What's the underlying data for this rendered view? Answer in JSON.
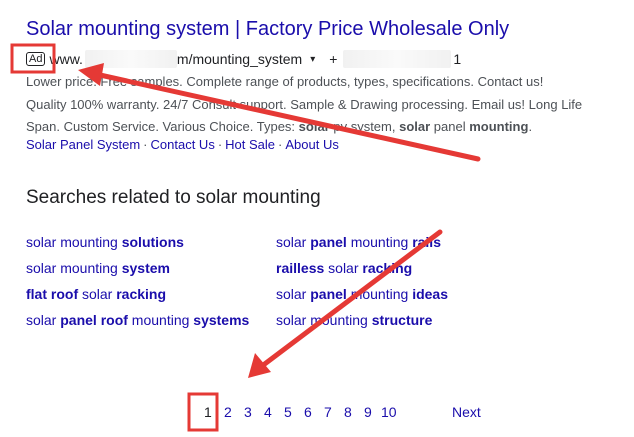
{
  "ad": {
    "title": "Solar mounting system | Factory Price Wholesale Only",
    "badge": "Ad",
    "url_prefix": "www.",
    "url_path": "m/mounting_system",
    "caret": "▾",
    "phone_prefix": "+",
    "phone_suffix": "1",
    "desc_line1": "Lower price. Free samples. Complete range of products, types, specifications. Contact us!",
    "desc_line2": "Quality 100% warranty. 24/7 Consult support. Sample & Drawing processing. Email us! Long Life",
    "desc_line3": {
      "part1": "Span. Custom Service. Various Choice. Types: ",
      "bold1": "solar",
      "part2": " pv system, ",
      "bold2": "solar",
      "part3": " panel ",
      "bold3": "mounting",
      "part4": "."
    },
    "sitelinks": [
      "Solar Panel System",
      "Contact Us",
      "Hot Sale",
      "About Us"
    ],
    "sitelink_separator": "·"
  },
  "related": {
    "heading": "Searches related to solar mounting",
    "left": [
      {
        "normal": "solar mounting ",
        "bold": "solutions"
      },
      {
        "normal": "solar mounting ",
        "bold": "system"
      },
      {
        "bold1": "flat roof",
        "normal": " solar ",
        "bold2": "racking"
      },
      {
        "normal1": "solar ",
        "bold1": "panel roof",
        "normal2": " mounting ",
        "bold2": "systems"
      }
    ],
    "right": [
      {
        "normal1": "solar ",
        "bold1": "panel",
        "normal2": " mounting ",
        "bold2": "rails"
      },
      {
        "bold1": "railless",
        "normal": " solar ",
        "bold2": "racking"
      },
      {
        "normal1": "solar ",
        "bold1": "panel",
        "normal2": " mounting ",
        "bold2": "ideas"
      },
      {
        "normal": "solar mounting ",
        "bold": "structure"
      }
    ]
  },
  "pagination": {
    "current": "1",
    "pages": [
      "2",
      "3",
      "4",
      "5",
      "6",
      "7",
      "8",
      "9",
      "10"
    ],
    "next": "Next"
  },
  "annotation_colors": {
    "box": "#e53935",
    "arrow": "#e53935"
  }
}
